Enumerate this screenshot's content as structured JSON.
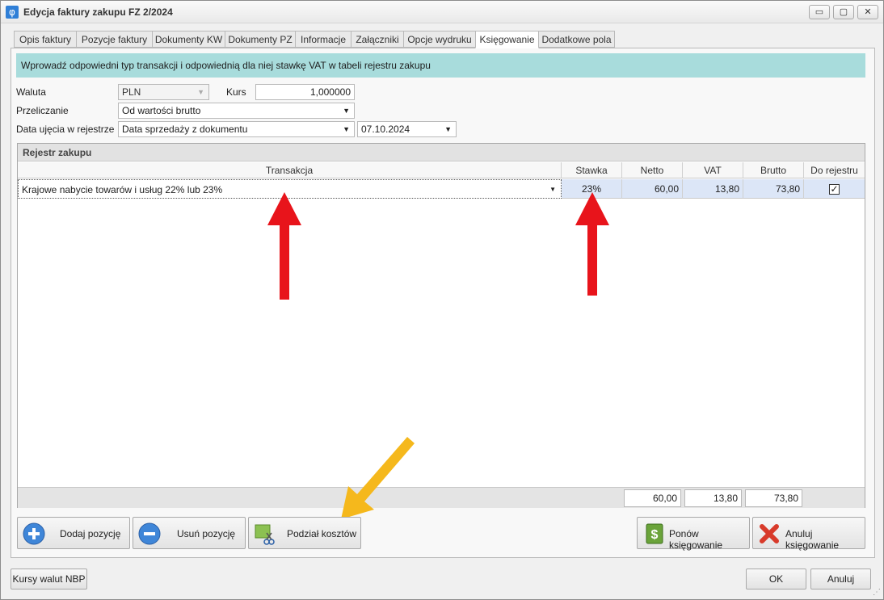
{
  "window": {
    "title": "Edycja faktury zakupu FZ 2/2024",
    "app_icon": "φ",
    "minimize_icon": "▭",
    "maximize_icon": "▢",
    "close_icon": "✕"
  },
  "tabs": [
    {
      "label": "Opis faktury",
      "active": false
    },
    {
      "label": "Pozycje faktury",
      "active": false
    },
    {
      "label": "Dokumenty KW",
      "active": false
    },
    {
      "label": "Dokumenty PZ",
      "active": false
    },
    {
      "label": "Informacje",
      "active": false
    },
    {
      "label": "Załączniki",
      "active": false
    },
    {
      "label": "Opcje wydruku",
      "active": false
    },
    {
      "label": "Księgowanie",
      "active": true
    },
    {
      "label": "Dodatkowe pola",
      "active": false
    }
  ],
  "info_text": "Wprowadź odpowiedni typ transakcji i odpowiednią dla niej stawkę VAT w tabeli rejestru zakupu",
  "form": {
    "waluta_label": "Waluta",
    "waluta_value": "PLN",
    "kurs_label": "Kurs",
    "kurs_value": "1,000000",
    "przeliczanie_label": "Przeliczanie",
    "przeliczanie_value": "Od wartości brutto",
    "data_label": "Data ujęcia w rejestrze",
    "data_type_value": "Data sprzedaży z dokumentu",
    "date_value": "07.10.2024",
    "dropdown_arrow": "▼"
  },
  "register": {
    "title": "Rejestr zakupu",
    "columns": [
      "Transakcja",
      "Stawka",
      "Netto",
      "VAT",
      "Brutto",
      "Do rejestru"
    ],
    "rows": [
      {
        "transakcja": "Krajowe nabycie towarów i usług 22% lub 23%",
        "stawka": "23%",
        "netto": "60,00",
        "vat": "13,80",
        "brutto": "73,80",
        "do_rejestru_check": "✓"
      }
    ],
    "totals": {
      "netto": "60,00",
      "vat": "13,80",
      "brutto": "73,80"
    }
  },
  "buttons": {
    "dodaj": "Dodaj pozycję",
    "usun": "Usuń pozycję",
    "podzial": "Podział kosztów",
    "ponow": "Ponów księgowanie",
    "anuluj_ksieg": "Anuluj księgowanie",
    "kursy": "Kursy walut NBP",
    "ok": "OK",
    "anuluj": "Anuluj"
  },
  "colors": {
    "info_bar": "#a8dcdc",
    "selected_row": "#dce6f7",
    "arrow_red": "#e8141b",
    "arrow_yellow": "#f5b81c"
  }
}
